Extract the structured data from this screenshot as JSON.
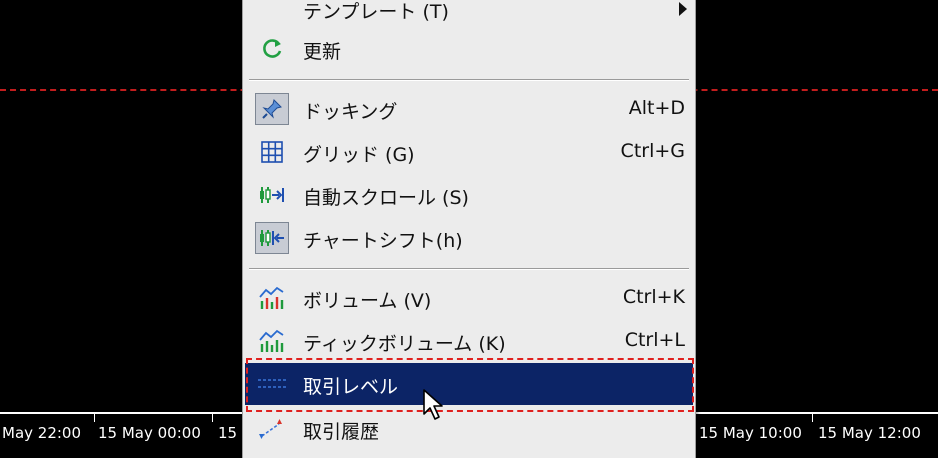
{
  "time_axis": {
    "labels": [
      "May 22:00",
      "15 May 00:00",
      "15",
      "15 May 10:00",
      "15 May 12:00"
    ]
  },
  "menu": {
    "template_item": {
      "label": "テンプレート (T)"
    },
    "refresh_item": {
      "label": "更新"
    },
    "docking_item": {
      "label": "ドッキング",
      "shortcut": "Alt+D",
      "checked": true
    },
    "grid_item": {
      "label": "グリッド (G)",
      "shortcut": "Ctrl+G"
    },
    "autoscroll_item": {
      "label": "自動スクロール (S)"
    },
    "chartshift_item": {
      "label": "チャートシフト(h)",
      "checked": true
    },
    "volume_item": {
      "label": "ボリューム (V)",
      "shortcut": "Ctrl+K"
    },
    "tickvolume_item": {
      "label": "ティックボリューム (K)",
      "shortcut": "Ctrl+L"
    },
    "tradelevels_item": {
      "label": "取引レベル",
      "highlighted": true
    },
    "tradehistory_item": {
      "label": "取引履歴"
    }
  },
  "colors": {
    "menu_background": "#ececec",
    "highlight_background": "#0c2466",
    "focus_outline": "#e0201e",
    "chart_line": "#c21d1d"
  },
  "icons": {
    "refresh": "refresh-icon",
    "docking": "pin-icon",
    "grid": "grid-icon",
    "autoscroll": "autoscroll-icon",
    "chartshift": "chart-shift-icon",
    "volume": "volume-icon",
    "tickvolume": "tick-volume-icon",
    "tradelevels": "trade-levels-icon",
    "tradehistory": "trade-history-icon"
  }
}
